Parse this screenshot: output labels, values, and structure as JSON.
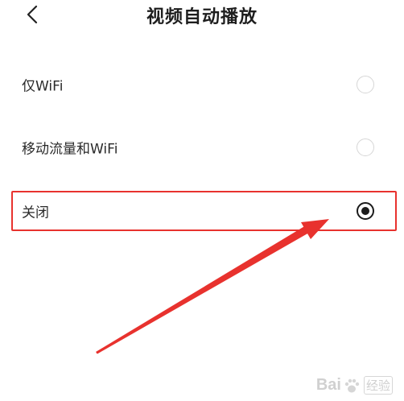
{
  "header": {
    "back_icon": "chevron-left-icon",
    "title": "视频自动播放"
  },
  "options": [
    {
      "label": "仅WiFi",
      "selected": false
    },
    {
      "label": "移动流量和WiFi",
      "selected": false
    },
    {
      "label": "关闭",
      "selected": true
    }
  ],
  "annotation": {
    "highlight_color": "#e8322e",
    "arrow_color": "#e8322e"
  },
  "watermark": {
    "left_text": "Bai",
    "right_text": "经验"
  },
  "colors": {
    "text": "#2a2a2a",
    "radio_checked": "#1b1b1b",
    "radio_unchecked_border": "#d6d6d6"
  }
}
